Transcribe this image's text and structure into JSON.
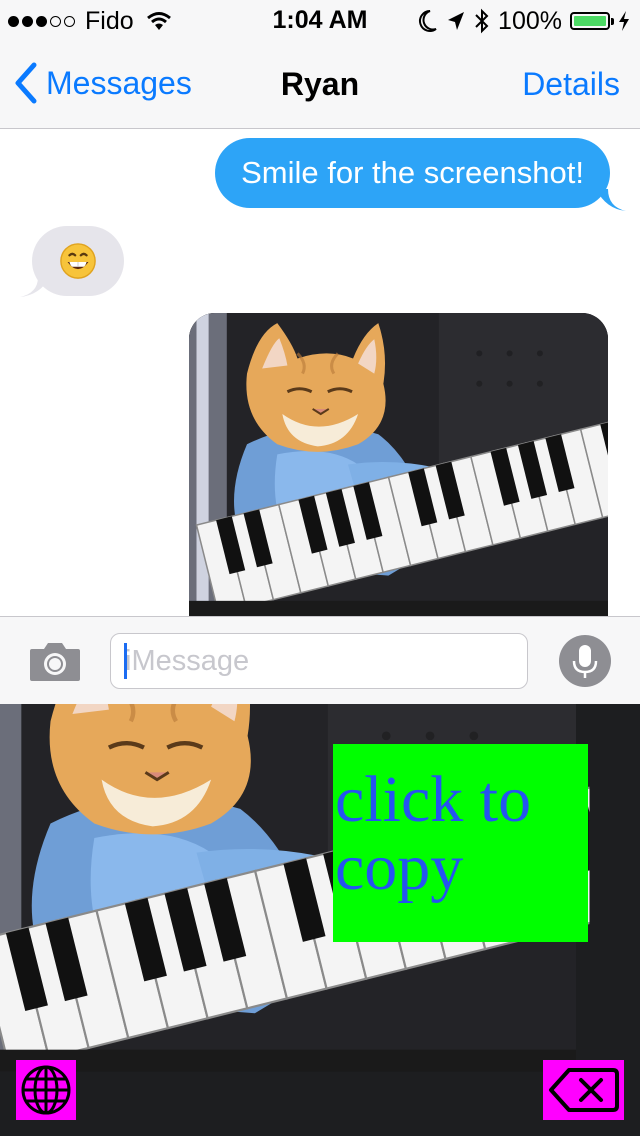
{
  "status_bar": {
    "signal_filled": 3,
    "signal_total": 5,
    "carrier": "Fido",
    "time": "1:04 AM",
    "battery_percent": "100%",
    "battery_level": 1.0,
    "icons": [
      "wifi-icon",
      "moon-icon",
      "location-icon",
      "bluetooth-icon",
      "charging-icon"
    ]
  },
  "nav": {
    "back_label": "Messages",
    "title": "Ryan",
    "details_label": "Details"
  },
  "messages": [
    {
      "direction": "outgoing",
      "type": "text",
      "text": "Smile for the screenshot!"
    },
    {
      "direction": "incoming",
      "type": "emoji",
      "emoji": "grinning-face"
    },
    {
      "direction": "outgoing",
      "type": "image",
      "subject": "cat-playing-keyboard"
    }
  ],
  "input_bar": {
    "placeholder": "iMessage",
    "value": ""
  },
  "keyboard": {
    "copy_label": "click to copy",
    "background_subject": "cat-playing-keyboard",
    "accent_green": "#00ff00",
    "accent_magenta": "#ff00ff",
    "icons": [
      "globe-icon",
      "delete-icon"
    ]
  },
  "colors": {
    "ios_blue": "#0a7aff",
    "outgoing_bubble": "#2da4f7",
    "incoming_bubble": "#e6e5eb",
    "battery_green": "#4cd964"
  }
}
